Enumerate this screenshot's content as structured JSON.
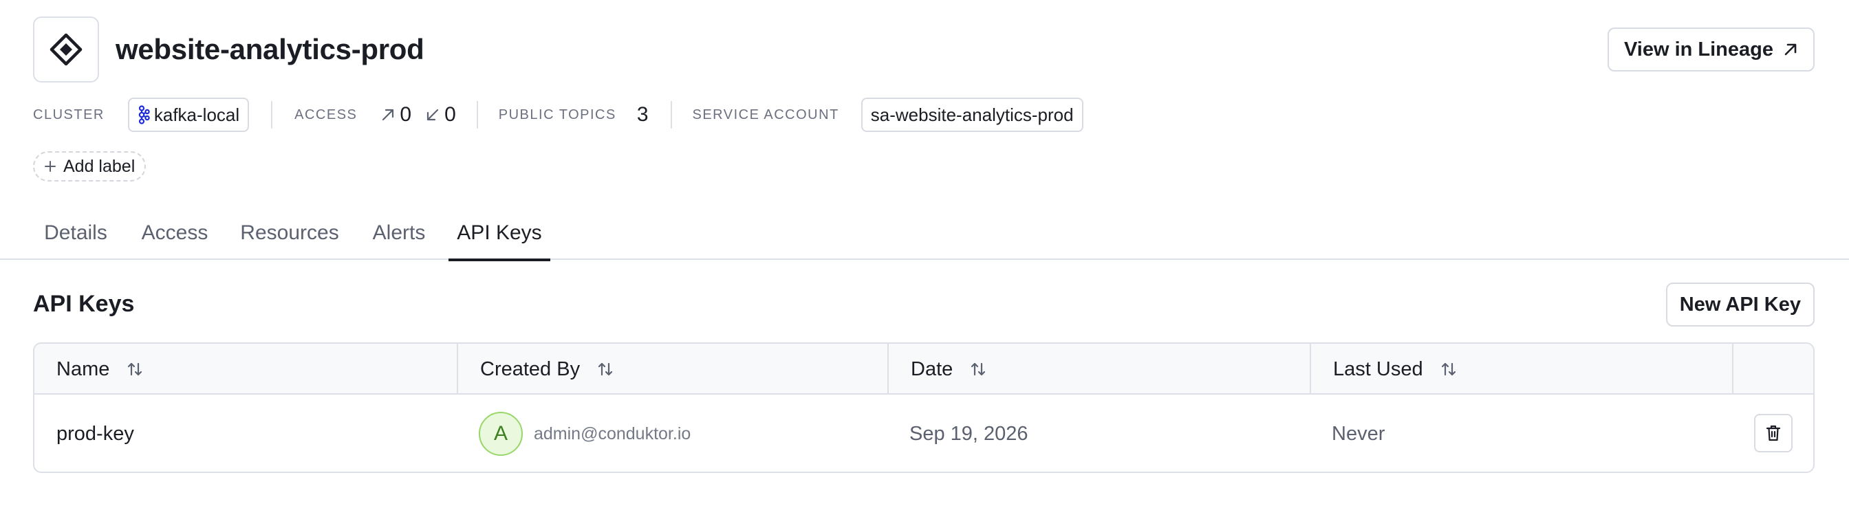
{
  "header": {
    "title": "website-analytics-prod",
    "icon": "diamond-logo-icon",
    "lineage_button": "View in Lineage"
  },
  "meta": {
    "cluster_label": "CLUSTER",
    "cluster_value": "kafka-local",
    "access_label": "ACCESS",
    "access_out": "0",
    "access_in": "0",
    "public_topics_label": "PUBLIC TOPICS",
    "public_topics_value": "3",
    "service_account_label": "SERVICE ACCOUNT",
    "service_account_value": "sa-website-analytics-prod"
  },
  "add_label": "Add label",
  "tabs": [
    {
      "label": "Details"
    },
    {
      "label": "Access"
    },
    {
      "label": "Resources"
    },
    {
      "label": "Alerts"
    },
    {
      "label": "API Keys",
      "active": true
    }
  ],
  "section": {
    "title": "API Keys",
    "new_button": "New API Key"
  },
  "table": {
    "columns": [
      "Name",
      "Created By",
      "Date",
      "Last Used"
    ],
    "rows": [
      {
        "name": "prod-key",
        "avatar_initial": "A",
        "created_by": "admin@conduktor.io",
        "date": "Sep 19, 2026",
        "last_used": "Never"
      }
    ]
  },
  "colors": {
    "text": "#1b1d24",
    "muted": "#5c6170",
    "border": "#dde0e6",
    "cluster_icon": "#1d2bd8",
    "avatar_bg": "#eaf9dd",
    "avatar_border": "#9ad76b"
  }
}
